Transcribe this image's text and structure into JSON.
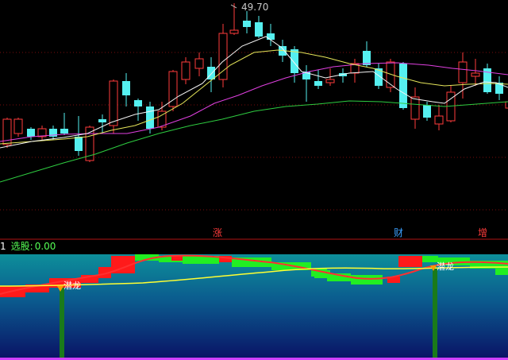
{
  "main_chart": {
    "high_price_label": "49.70",
    "event_tags": [
      {
        "text": "涨",
        "color": "#ff3b3b"
      },
      {
        "text": "财",
        "color": "#3aa0ff"
      },
      {
        "text": "增",
        "color": "#ff3b3b"
      }
    ],
    "colors": {
      "up": "#ff3b3b",
      "down": "#55f0f0",
      "ma5": "#ffffff",
      "ma10": "#e6e65a",
      "ma20": "#e040e0",
      "ma60": "#2ecc40",
      "grid": "#8a1010"
    }
  },
  "indicator": {
    "name_suffix": "1",
    "select_label": "选股:",
    "select_value": "0.00",
    "marker_label": "潜龙",
    "colors": {
      "band_top": "#0d7f8c",
      "band_bottom": "#0a1a66",
      "red_blocks": "#ff1a1a",
      "green_blocks": "#22ee22",
      "curve_red": "#ff3030",
      "curve_yellow": "#ffff33",
      "signal_bar": "#1a7a1a"
    }
  }
}
